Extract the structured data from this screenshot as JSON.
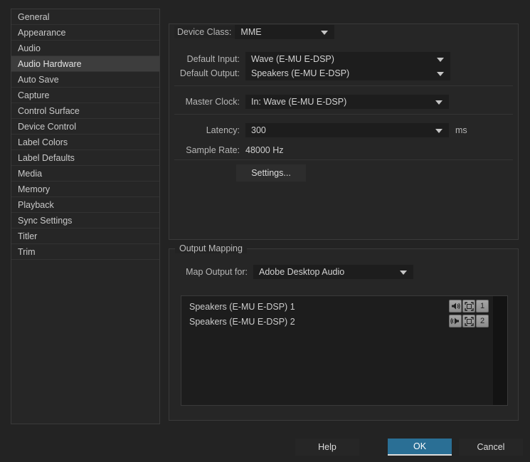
{
  "sidebar": {
    "items": [
      {
        "label": "General",
        "selected": false
      },
      {
        "label": "Appearance",
        "selected": false
      },
      {
        "label": "Audio",
        "selected": false
      },
      {
        "label": "Audio Hardware",
        "selected": true
      },
      {
        "label": "Auto Save",
        "selected": false
      },
      {
        "label": "Capture",
        "selected": false
      },
      {
        "label": "Control Surface",
        "selected": false
      },
      {
        "label": "Device Control",
        "selected": false
      },
      {
        "label": "Label Colors",
        "selected": false
      },
      {
        "label": "Label Defaults",
        "selected": false
      },
      {
        "label": "Media",
        "selected": false
      },
      {
        "label": "Memory",
        "selected": false
      },
      {
        "label": "Playback",
        "selected": false
      },
      {
        "label": "Sync Settings",
        "selected": false
      },
      {
        "label": "Titler",
        "selected": false
      },
      {
        "label": "Trim",
        "selected": false
      }
    ]
  },
  "device_group": {
    "device_class": {
      "label": "Device Class:",
      "value": "MME"
    },
    "default_input": {
      "label": "Default Input:",
      "value": "Wave (E-MU E-DSP)"
    },
    "default_output": {
      "label": "Default Output:",
      "value": "Speakers (E-MU E-DSP)"
    },
    "master_clock": {
      "label": "Master Clock:",
      "value": "In: Wave (E-MU E-DSP)"
    },
    "latency": {
      "label": "Latency:",
      "value": "300",
      "unit": "ms"
    },
    "sample_rate": {
      "label": "Sample Rate:",
      "value": "48000 Hz"
    },
    "settings_button": "Settings..."
  },
  "output_mapping": {
    "legend": "Output Mapping",
    "map_output_for": {
      "label": "Map Output for:",
      "value": "Adobe Desktop Audio"
    },
    "channels": [
      {
        "name": "Speakers (E-MU E-DSP) 1",
        "number": "1",
        "speaker_icon": "speaker-left-icon",
        "frame_icon": "channel-frame-icon"
      },
      {
        "name": "Speakers (E-MU E-DSP) 2",
        "number": "2",
        "speaker_icon": "speaker-right-icon",
        "frame_icon": "channel-frame-icon"
      }
    ]
  },
  "footer": {
    "help": "Help",
    "ok": "OK",
    "cancel": "Cancel"
  },
  "colors": {
    "accent": "#2a6f95",
    "panel": "#262626",
    "background": "#232323",
    "field": "#1d1d1d",
    "selection": "#3d3d3d"
  }
}
